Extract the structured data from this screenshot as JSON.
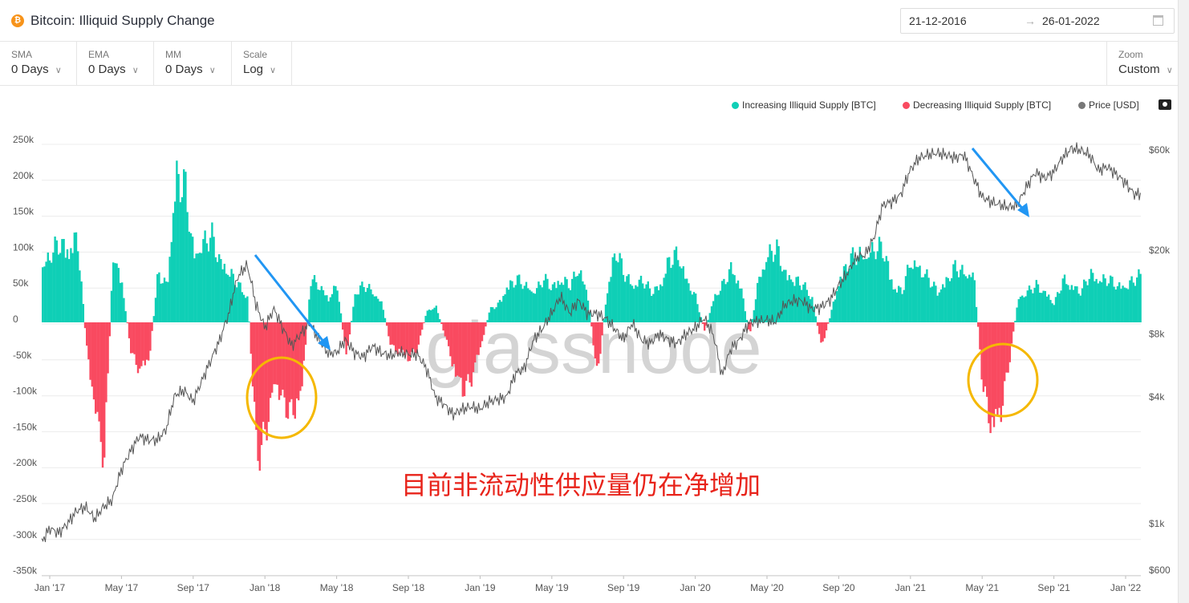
{
  "header": {
    "title": "Bitcoin: Illiquid Supply Change",
    "icon": "bitcoin-icon",
    "date_from": "21-12-2016",
    "date_arrow": "→",
    "date_to": "26-01-2022"
  },
  "toolbar": {
    "sma": {
      "label": "SMA",
      "value": "0 Days"
    },
    "ema": {
      "label": "EMA",
      "value": "0 Days"
    },
    "mm": {
      "label": "MM",
      "value": "0 Days"
    },
    "scale": {
      "label": "Scale",
      "value": "Log"
    },
    "zoom": {
      "label": "Zoom",
      "value": "Custom"
    }
  },
  "watermark": "glassnode",
  "annotation_text": "目前非流动性供应量仍在净增加",
  "chart_data": {
    "type": "bar",
    "legend": [
      {
        "label": "Increasing Illiquid Supply [BTC]",
        "color": "#0fcfb6"
      },
      {
        "label": "Decreasing Illiquid Supply [BTC]",
        "color": "#f94a60"
      },
      {
        "label": "Price [USD]",
        "color": "#777777"
      }
    ],
    "legend_position": "top-right",
    "x_start": "2016-12-16",
    "x_interval": "semi-monthly",
    "x_ticks": [
      "Jan '17",
      "May '17",
      "Sep '17",
      "Jan '18",
      "May '18",
      "Sep '18",
      "Jan '19",
      "May '19",
      "Sep '19",
      "Jan '20",
      "May '20",
      "Sep '20",
      "Jan '21",
      "May '21",
      "Sep '21",
      "Jan '22"
    ],
    "y_left_ticks": [
      "250k",
      "200k",
      "150k",
      "100k",
      "50k",
      "0",
      "-50k",
      "-100k",
      "-150k",
      "-200k",
      "-250k",
      "-300k",
      "-350k"
    ],
    "y_left_range": [
      -350000,
      250000
    ],
    "y_right_ticks": [
      "$60k",
      "$20k",
      "$8k",
      "$4k",
      "$1k",
      "$600"
    ],
    "y_right_tick_values": [
      60000,
      20000,
      8000,
      4000,
      1000,
      600
    ],
    "y_right_range": [
      600,
      60000
    ],
    "y_right_scale": "log",
    "grid": true,
    "illiquid_supply_change_k": [
      90,
      110,
      130,
      120,
      140,
      -40,
      -150,
      -220,
      120,
      60,
      -50,
      -80,
      -60,
      80,
      60,
      240,
      220,
      110,
      130,
      140,
      100,
      80,
      60,
      40,
      -220,
      -180,
      -100,
      -130,
      -150,
      -120,
      70,
      60,
      40,
      60,
      -60,
      50,
      60,
      50,
      30,
      -40,
      -50,
      -60,
      -40,
      20,
      25,
      -20,
      -80,
      -110,
      -90,
      -40,
      20,
      30,
      60,
      70,
      60,
      50,
      70,
      60,
      70,
      60,
      90,
      40,
      -90,
      40,
      120,
      80,
      60,
      70,
      50,
      60,
      100,
      110,
      70,
      40,
      -15,
      40,
      60,
      90,
      60,
      -20,
      70,
      110,
      120,
      80,
      70,
      60,
      40,
      -40,
      10,
      70,
      100,
      110,
      110,
      120,
      120,
      60,
      50,
      100,
      90,
      70,
      50,
      70,
      90,
      80,
      80,
      -100,
      -180,
      -150,
      -60,
      40,
      50,
      60,
      50,
      30,
      70,
      60,
      50,
      80,
      70,
      70,
      60,
      60,
      70,
      80
    ],
    "price_usd": [
      800,
      950,
      900,
      1000,
      1150,
      1200,
      1050,
      1200,
      1300,
      1800,
      2200,
      2600,
      2500,
      2500,
      2800,
      4100,
      4300,
      3800,
      4800,
      6000,
      7500,
      10000,
      15000,
      17000,
      11000,
      8500,
      10500,
      8500,
      7000,
      8000,
      9000,
      7500,
      6500,
      6500,
      7500,
      6500,
      6200,
      7000,
      6500,
      6300,
      6500,
      6400,
      6400,
      5500,
      4000,
      3700,
      3300,
      3500,
      3600,
      3500,
      3800,
      3900,
      4000,
      5200,
      5500,
      7500,
      8500,
      10000,
      12000,
      10000,
      11500,
      10000,
      10000,
      9500,
      8500,
      7500,
      9000,
      7500,
      7200,
      8000,
      7500,
      7200,
      8000,
      8500,
      9500,
      8000,
      5000,
      6800,
      7500,
      9000,
      9200,
      9300,
      9100,
      11000,
      11500,
      11500,
      10500,
      10700,
      11500,
      13500,
      15500,
      18500,
      19000,
      23000,
      33000,
      34000,
      37000,
      48000,
      55000,
      57000,
      58000,
      57000,
      55000,
      57000,
      45000,
      36000,
      34000,
      33000,
      32000,
      33000,
      40000,
      47000,
      44000,
      47000,
      55000,
      61000,
      60000,
      57000,
      48000,
      50000,
      46000,
      42000,
      37000
    ]
  }
}
